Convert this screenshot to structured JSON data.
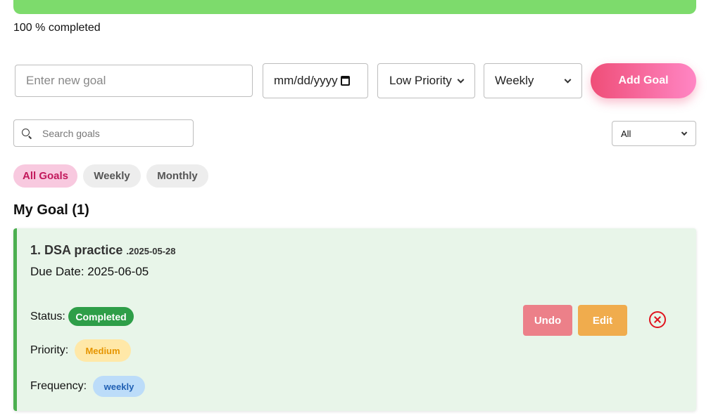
{
  "progress": {
    "fraction_completed": 1.0,
    "label": "100 % completed",
    "color": "#7ddb6c"
  },
  "form": {
    "goal_placeholder": "Enter new goal",
    "date_placeholder": "mm/dd/yyyy",
    "priority_selected": "Low Priority",
    "frequency_selected": "Weekly",
    "add_button": "Add Goal"
  },
  "search": {
    "placeholder": "Search goals",
    "icon": "search-icon"
  },
  "filter": {
    "selected": "All"
  },
  "tabs": [
    {
      "label": "All Goals",
      "active": true
    },
    {
      "label": "Weekly",
      "active": false
    },
    {
      "label": "Monthly",
      "active": false
    }
  ],
  "section_title": "My Goal (1)",
  "goals": [
    {
      "title": "1. DSA practice",
      "created": ".2025-05-28",
      "due": "Due Date: 2025-06-05",
      "status_label": "Status:",
      "status": "Completed",
      "priority_label": "Priority:",
      "priority": "Medium",
      "frequency_label": "Frequency:",
      "frequency": "weekly",
      "undo_label": "Undo",
      "edit_label": "Edit",
      "delete_icon": "close-circle-icon"
    }
  ],
  "colors": {
    "accent_start": "#ef4e78",
    "accent_end": "#ff86c4",
    "card_bg": "#e8f5e9",
    "card_border": "#4caf50",
    "status_completed": "#2e9e48",
    "priority_medium_bg": "#ffe8a8",
    "frequency_bg": "#bcdcf9",
    "undo": "#ec8089",
    "edit": "#f0ac4d",
    "delete": "#e0141e"
  }
}
